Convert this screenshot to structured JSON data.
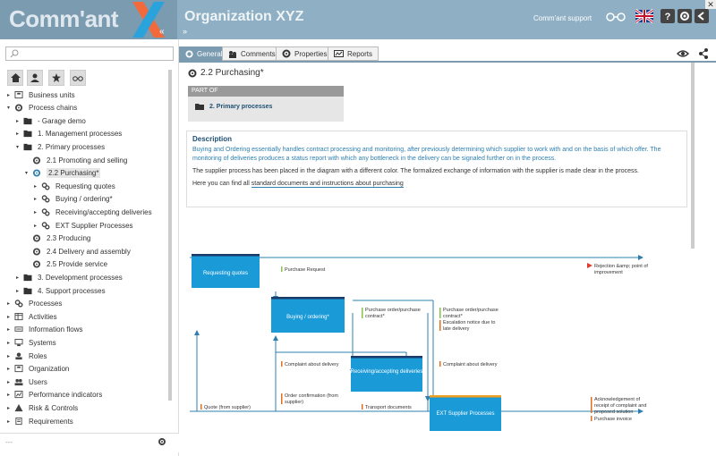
{
  "header": {
    "logo_text": "Comm'ant",
    "expand_glyph": "«",
    "org_title": "Organization XYZ",
    "org_expand": "»",
    "support_label": "Comm'ant support",
    "colors": {
      "header_bg": "#8fb0c4",
      "logo_bg": "#7a9bb0",
      "accent": "#2aa3dc",
      "orange": "#f26a3c"
    },
    "close_glyph": "✕"
  },
  "left": {
    "search_placeholder": "",
    "nav_icons": [
      "home-icon",
      "user-icon",
      "star-icon",
      "glasses-icon"
    ],
    "tree": [
      {
        "label": "Business units",
        "level": 0,
        "icon": "org-icon",
        "arrow": "▸"
      },
      {
        "label": "Process chains",
        "level": 0,
        "icon": "gear-icon",
        "arrow": "▾"
      },
      {
        "label": "- Garage demo",
        "level": 1,
        "icon": "folder-icon",
        "arrow": "▸"
      },
      {
        "label": "1. Management processes",
        "level": 1,
        "icon": "folder-icon",
        "arrow": "▸"
      },
      {
        "label": "2. Primary processes",
        "level": 1,
        "icon": "folder-icon",
        "arrow": "▾"
      },
      {
        "label": "2.1 Promoting and selling",
        "level": 2,
        "icon": "gear-icon",
        "arrow": ""
      },
      {
        "label": "2.2 Purchasing*",
        "level": 2,
        "icon": "gear-blue-icon",
        "arrow": "▾",
        "selected": true
      },
      {
        "label": "Requesting quotes",
        "level": 3,
        "icon": "gears-icon",
        "arrow": "▸"
      },
      {
        "label": "Buying / ordering*",
        "level": 3,
        "icon": "gears-icon",
        "arrow": "▸"
      },
      {
        "label": "Receiving/accepting deliveries",
        "level": 3,
        "icon": "gears-icon",
        "arrow": "▸"
      },
      {
        "label": "EXT Supplier Processes",
        "level": 3,
        "icon": "gears-icon",
        "arrow": "▸"
      },
      {
        "label": "2.3 Producing",
        "level": 2,
        "icon": "gear-icon",
        "arrow": ""
      },
      {
        "label": "2.4 Delivery and assembly",
        "level": 2,
        "icon": "gear-icon",
        "arrow": ""
      },
      {
        "label": "2.5 Provide service",
        "level": 2,
        "icon": "gear-icon",
        "arrow": ""
      },
      {
        "label": "3. Development processes",
        "level": 1,
        "icon": "folder-icon",
        "arrow": "▸"
      },
      {
        "label": "4. Support processes",
        "level": 1,
        "icon": "folder-icon",
        "arrow": "▸"
      },
      {
        "label": "Processes",
        "level": 0,
        "icon": "gears-icon",
        "arrow": "▸"
      },
      {
        "label": "Activities",
        "level": 0,
        "icon": "table-icon",
        "arrow": "▸"
      },
      {
        "label": "Information flows",
        "level": 0,
        "icon": "flow-icon",
        "arrow": "▸"
      },
      {
        "label": "Systems",
        "level": 0,
        "icon": "system-icon",
        "arrow": "▸"
      },
      {
        "label": "Roles",
        "level": 0,
        "icon": "role-icon",
        "arrow": "▸"
      },
      {
        "label": "Organization",
        "level": 0,
        "icon": "org-icon",
        "arrow": "▸"
      },
      {
        "label": "Users",
        "level": 0,
        "icon": "users-icon",
        "arrow": "▸"
      },
      {
        "label": "Performance indicators",
        "level": 0,
        "icon": "kpi-icon",
        "arrow": "▸"
      },
      {
        "label": "Risk & Controls",
        "level": 0,
        "icon": "warning-icon",
        "arrow": "▸"
      },
      {
        "label": "Requirements",
        "level": 0,
        "icon": "doc-icon",
        "arrow": "▸"
      }
    ],
    "footer_left": "---"
  },
  "tabs": [
    {
      "label": "General",
      "icon": "gear-icon",
      "active": true
    },
    {
      "label": "Comments",
      "icon": "comments-icon",
      "active": false
    },
    {
      "label": "Properties",
      "icon": "settings-icon",
      "active": false
    },
    {
      "label": "Reports",
      "icon": "report-icon",
      "active": false
    }
  ],
  "page": {
    "title": "2.2 Purchasing*",
    "part_of_header": "PART OF",
    "part_of_value": "2. Primary processes",
    "desc_header": "Description",
    "desc_p1": "Buying and Ordering essentially handles contract processing and monitoring, after previously determining which supplier to work with and on the basis of which offer. The monitoring of deliveries produces a status report with which any bottleneck in the delivery can be signaled further on in the process.",
    "desc_p2": "The supplier process has been placed in the diagram with a different color. The formalized exchange of information with the supplier is made clear in the process.",
    "desc_p3_prefix": "Here you can find all ",
    "desc_p3_link": "standard documents and instructions about purchasing"
  },
  "diagram": {
    "boxes": {
      "requesting": "Requesting quotes",
      "buying": "Buying / ordering*",
      "receiving": "Receiving/accepting deliveries",
      "ext": "EXT Supplier Processes"
    },
    "labels": {
      "purchase_request": "Purchase Request",
      "rejection": "Rejection &amp; point of improvement",
      "po_contract_1": "Purchase order/purchase contract*",
      "po_contract_2": "Purchase order/purchase contract*",
      "escalation": "Escalation notice due to late delivery",
      "complaint_1": "Complaint about delivery",
      "complaint_2": "Complaint about delivery",
      "order_confirmation": "Order confirmation (from supplier)",
      "quote": "Quote (from supplier)",
      "transport": "Transport documents",
      "acknowledgement": "Acknowledgement of receipt of complaint and proposed solution",
      "purchase_invoice": "Purchase invoice"
    }
  }
}
